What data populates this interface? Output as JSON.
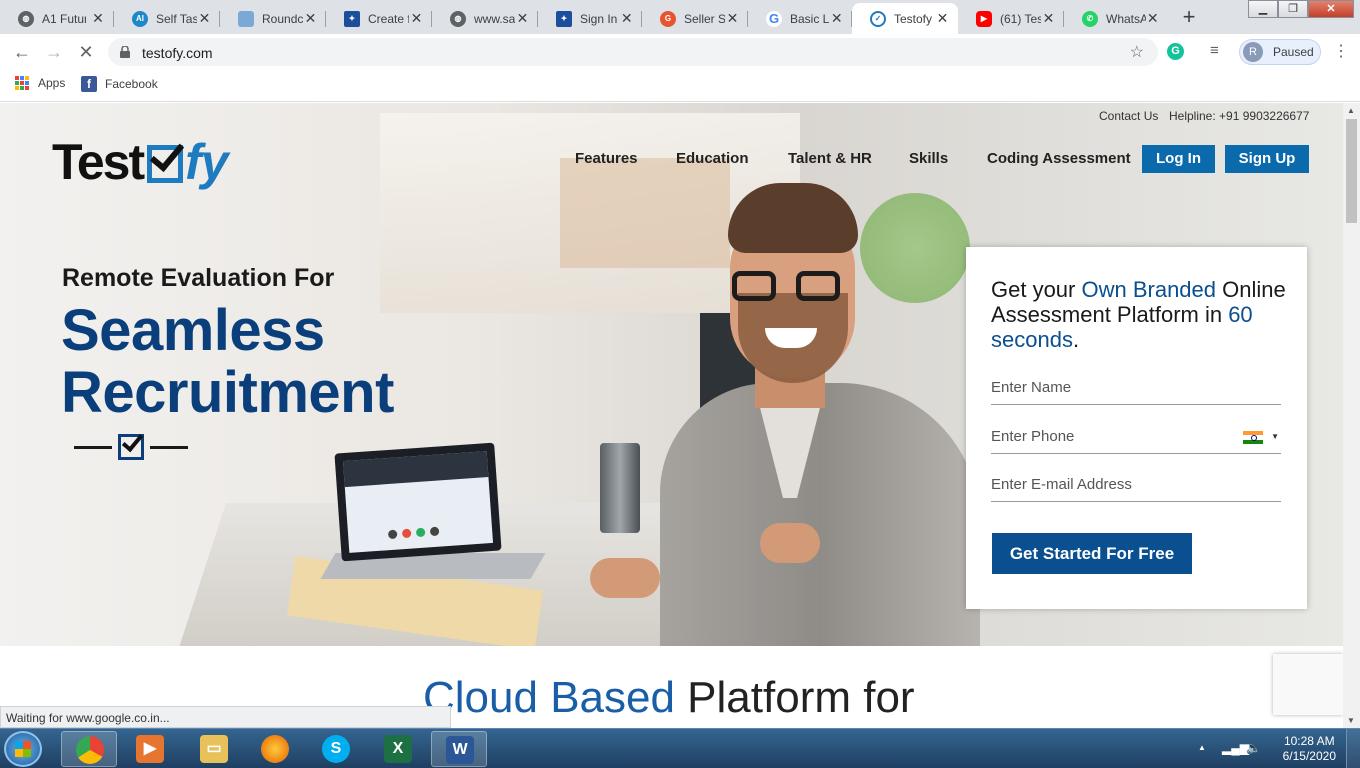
{
  "browser": {
    "tabs": [
      {
        "title": "A1 Futur",
        "favicon": "globe-icon",
        "active": false
      },
      {
        "title": "Self Tas",
        "favicon": "ai-icon",
        "active": false
      },
      {
        "title": "Roundc",
        "favicon": "roundcube-icon",
        "active": false
      },
      {
        "title": "Create f",
        "favicon": "star-logo-icon",
        "active": false
      },
      {
        "title": "www.sa",
        "favicon": "globe-icon",
        "active": false
      },
      {
        "title": "Sign In",
        "favicon": "star-logo-icon",
        "active": false
      },
      {
        "title": "Seller S",
        "favicon": "g-orange-icon",
        "active": false
      },
      {
        "title": "Basic Li",
        "favicon": "google-icon",
        "active": false
      },
      {
        "title": "Testofy",
        "favicon": "testofy-icon",
        "active": true
      },
      {
        "title": "(61) Tes",
        "favicon": "youtube-icon",
        "active": false
      },
      {
        "title": "WhatsA",
        "favicon": "whatsapp-icon",
        "active": false
      }
    ],
    "url": "testofy.com",
    "profile_initial": "R",
    "profile_status": "Paused",
    "bookmarks": [
      {
        "label": "Apps",
        "icon": "apps-grid-icon"
      },
      {
        "label": "Facebook",
        "icon": "facebook-icon"
      }
    ],
    "status_bar": "Waiting for www.google.co.in..."
  },
  "page": {
    "contact_link": "Contact Us",
    "helpline": "Helpline: +91 9903226677",
    "logo": {
      "part1": "Test",
      "part2": "fy"
    },
    "nav": [
      "Features",
      "Education",
      "Talent & HR",
      "Skills",
      "Coding Assessment"
    ],
    "login_label": "Log In",
    "signup_label": "Sign Up",
    "hero": {
      "tagline": "Remote Evaluation For",
      "headline_line1": "Seamless",
      "headline_line2": "Recruitment"
    },
    "form": {
      "title_pre": "Get your ",
      "title_hl1": "Own Branded",
      "title_mid": " Online Assessment Platform in ",
      "title_hl2": "60 seconds",
      "title_post": ".",
      "name_placeholder": "Enter Name",
      "phone_placeholder": "Enter Phone",
      "email_placeholder": "Enter E-mail Address",
      "cta_label": "Get Started For Free"
    },
    "section_heading": {
      "highlight": "Cloud Based",
      "rest": " Platform for"
    },
    "colors": {
      "brand_blue": "#0a3f7c",
      "button_blue": "#0a6aab",
      "cta_blue": "#0a4f8f"
    }
  },
  "taskbar": {
    "apps": [
      {
        "name": "chrome-icon",
        "active": true
      },
      {
        "name": "media-player-icon",
        "active": false
      },
      {
        "name": "file-explorer-icon",
        "active": false
      },
      {
        "name": "firefox-icon",
        "active": false
      },
      {
        "name": "skype-icon",
        "active": false
      },
      {
        "name": "excel-icon",
        "active": false
      },
      {
        "name": "word-icon",
        "active": true
      }
    ],
    "time": "10:28 AM",
    "date": "6/15/2020"
  }
}
